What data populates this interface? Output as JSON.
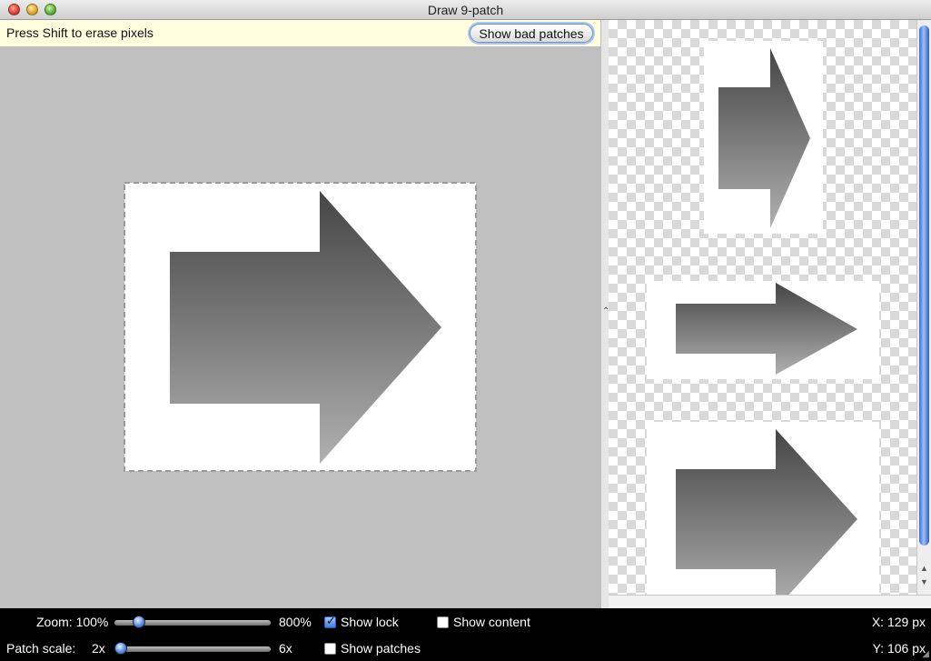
{
  "window": {
    "title": "Draw 9-patch"
  },
  "editor": {
    "hint": "Press Shift to erase pixels",
    "show_bad_patches_label": "Show bad patches"
  },
  "controls": {
    "zoom_label": "Zoom: 100%",
    "zoom_max_label": "800%",
    "zoom_percent": 100,
    "patch_scale_label": "Patch scale:",
    "patch_scale_min_label": "2x",
    "patch_scale_max_label": "6x",
    "patch_scale_value": 2,
    "show_lock_label": "Show lock",
    "show_lock_checked": true,
    "show_content_label": "Show content",
    "show_content_checked": false,
    "show_patches_label": "Show patches",
    "show_patches_checked": false,
    "x_readout": "X: 129 px",
    "y_readout": "Y: 106 px"
  },
  "colors": {
    "editor_bg": "#c0c0c0",
    "hint_bg": "#ffffe0",
    "arrow_dark": "#555555",
    "arrow_light": "#a8a8a8",
    "accent": "#3b6fd6"
  }
}
